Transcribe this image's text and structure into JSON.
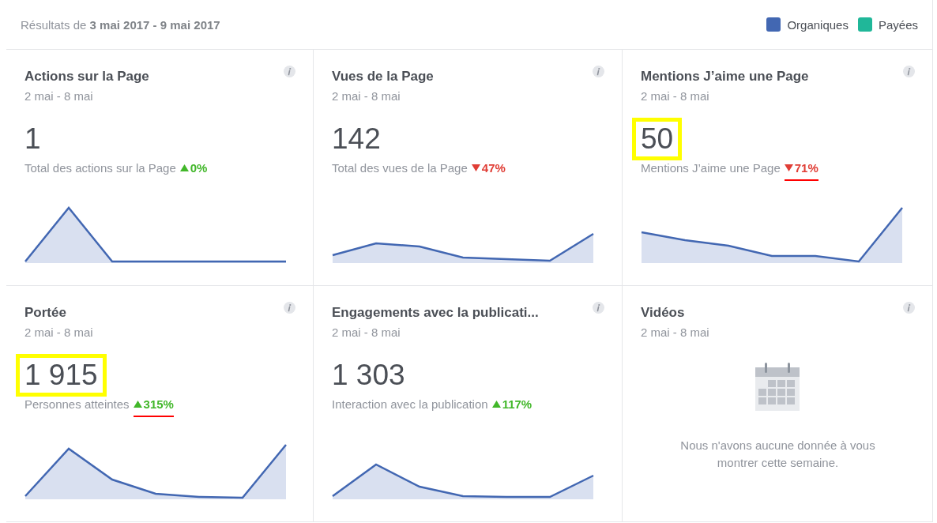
{
  "header": {
    "title": "Résultats de **3 mai 2017 - 9 mai 2017**",
    "legend": [
      {
        "label": "Organiques",
        "color": "#4267b2"
      },
      {
        "label": "Payées",
        "color": "#20b799"
      }
    ]
  },
  "cards": [
    {
      "kind": "chart",
      "title": "Actions sur la Page",
      "dates": "2 mai - 8 mai",
      "value": "1",
      "value_highlighted": false,
      "description": "Total des actions sur la Page",
      "change": "0%",
      "increase": true,
      "change_underlined": false
    },
    {
      "kind": "chart",
      "title": "Vues de la Page",
      "dates": "2 mai - 8 mai",
      "value": "142",
      "value_highlighted": false,
      "description": "Total des vues de la Page",
      "change": "47%",
      "increase": false,
      "change_underlined": false
    },
    {
      "kind": "chart",
      "title": "Mentions J’aime une Page",
      "dates": "2 mai - 8 mai",
      "value": "50",
      "value_highlighted": true,
      "description": "Mentions J’aime une Page",
      "change": "71%",
      "increase": false,
      "change_underlined": true
    },
    {
      "kind": "chart",
      "title": "Portée",
      "dates": "2 mai - 8 mai",
      "value": "1 915",
      "value_highlighted": true,
      "description": "Personnes atteintes",
      "change": "315%",
      "increase": true,
      "change_underlined": true
    },
    {
      "kind": "chart",
      "title": "Engagements avec la publicati...",
      "dates": "2 mai - 8 mai",
      "value": "1 303",
      "value_highlighted": false,
      "description": "Interaction avec la publication",
      "change": "117%",
      "increase": true,
      "change_underlined": false
    },
    {
      "kind": "empty",
      "title": "Vidéos",
      "dates": "2 mai - 8 mai",
      "message": "Nous n'avons aucune donnée à vous montrer cette semaine."
    }
  ]
}
